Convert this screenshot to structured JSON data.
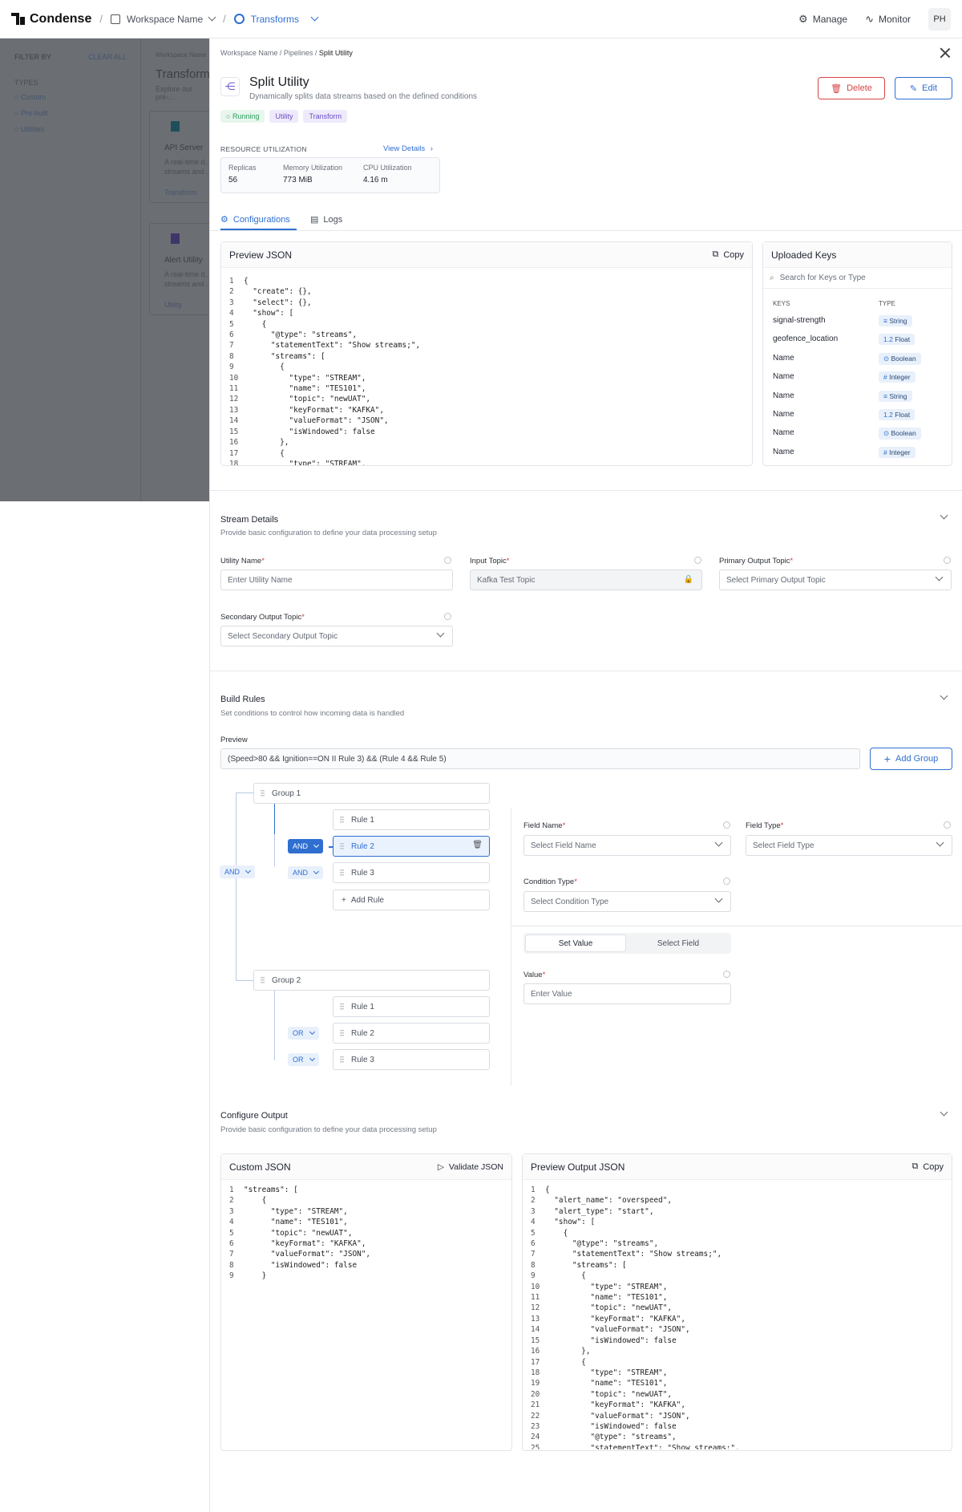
{
  "topbar": {
    "brand": "Condense",
    "workspace": "Workspace Name",
    "section": "Transforms",
    "nav": [
      "Manage",
      "Monitor"
    ],
    "avatar": "PH"
  },
  "background": {
    "filter_by": "FILTER BY",
    "clear_all": "CLEAR ALL",
    "types": "TYPES",
    "options": [
      "Custom",
      "Pre-built",
      "Utilities"
    ],
    "crumb": "Workspace Name",
    "heading": "Transforms",
    "desc": "Explore our pre-...",
    "cards": [
      {
        "title": "API Server",
        "line1": "A real-time d...",
        "line2": "streams and ...",
        "tag": "Transform"
      },
      {
        "title": "Alert Utility",
        "line1": "A real-time d...",
        "line2": "streams and ...",
        "tag": "Utility"
      }
    ]
  },
  "panel": {
    "breadcrumb": [
      "Workspace Name",
      "Pipelines",
      "Split Utility"
    ],
    "title": "Split Utility",
    "subtitle": "Dynamically splits data streams based on the defined conditions",
    "tags": [
      "Running",
      "Utility",
      "Transform"
    ],
    "delete_label": "Delete",
    "edit_label": "Edit",
    "resource": {
      "heading": "RESOURCE UTILIZATION",
      "link": "View Details",
      "metrics": [
        {
          "label": "Replicas",
          "value": "56"
        },
        {
          "label": "Memory Utilization",
          "value": "773 MiB"
        },
        {
          "label": "CPU Utilization",
          "value": "4.16 m"
        }
      ]
    },
    "tabs": [
      "Configurations",
      "Logs"
    ],
    "preview_json": {
      "title": "Preview JSON",
      "copy": "Copy",
      "lines": [
        "{",
        "  \"create\": {},",
        "  \"select\": {},",
        "  \"show\": [",
        "    {",
        "      \"@type\": \"streams\",",
        "      \"statementText\": \"Show streams;\",",
        "      \"streams\": [",
        "        {",
        "          \"type\": \"STREAM\",",
        "          \"name\": \"TES101\",",
        "          \"topic\": \"newUAT\",",
        "          \"keyFormat\": \"KAFKA\",",
        "          \"valueFormat\": \"JSON\",",
        "          \"isWindowed\": false",
        "        },",
        "        {",
        "          \"type\": \"STREAM\","
      ]
    },
    "uploaded_keys": {
      "title": "Uploaded Keys",
      "search_placeholder": "Search for Keys or Type",
      "col_keys": "KEYS",
      "col_type": "TYPE",
      "rows": [
        {
          "key": "signal-strength",
          "type": "String",
          "icon": "≡"
        },
        {
          "key": "geofence_location",
          "type": "Float",
          "icon": "1.2"
        },
        {
          "key": "Name",
          "type": "Boolean",
          "icon": "⊙"
        },
        {
          "key": "Name",
          "type": "Integer",
          "icon": "#"
        },
        {
          "key": "Name",
          "type": "String",
          "icon": "≡"
        },
        {
          "key": "Name",
          "type": "Float",
          "icon": "1.2"
        },
        {
          "key": "Name",
          "type": "Boolean",
          "icon": "⊙"
        },
        {
          "key": "Name",
          "type": "Integer",
          "icon": "#"
        }
      ]
    },
    "stream_details": {
      "title": "Stream Details",
      "subtitle": "Provide basic configuration to define your data processing setup",
      "utility_name_label": "Utility Name",
      "utility_name_placeholder": "Enter Utility Name",
      "input_topic_label": "Input Topic",
      "input_topic_value": "Kafka Test Topic",
      "primary_label": "Primary Output Topic",
      "primary_placeholder": "Select Primary Output Topic",
      "secondary_label": "Secondary Output Topic",
      "secondary_placeholder": "Select Secondary Output Topic"
    },
    "build_rules": {
      "title": "Build Rules",
      "subtitle": "Set conditions to control how incoming data is handled",
      "preview_label": "Preview",
      "preview_value": "(Speed>80 && Ignition==ON II Rule 3) && (Rule 4 && Rule 5)",
      "add_group": "Add Group",
      "root_op": "AND",
      "group1": {
        "name": "Group 1",
        "rules": [
          "Rule 1",
          "Rule 2",
          "Rule 3"
        ],
        "ops": [
          "AND",
          "AND"
        ],
        "add_rule": "Add Rule"
      },
      "group2": {
        "name": "Group 2",
        "rules": [
          "Rule 1",
          "Rule 2",
          "Rule 3"
        ],
        "ops": [
          "OR",
          "OR"
        ]
      },
      "field_name_label": "Field Name",
      "field_name_placeholder": "Select Field Name",
      "field_type_label": "Field Type",
      "field_type_placeholder": "Select Field Type",
      "condition_label": "Condition Type",
      "condition_placeholder": "Select Condition Type",
      "toggle": [
        "Set Value",
        "Select Field"
      ],
      "value_label": "Value",
      "value_placeholder": "Enter Value"
    },
    "configure_output": {
      "title": "Configure Output",
      "subtitle": "Provide basic configuration to define your data processing setup",
      "custom_title": "Custom JSON",
      "validate": "Validate JSON",
      "custom_lines": [
        "\"streams\": [",
        "    {",
        "      \"type\": \"STREAM\",",
        "      \"name\": \"TES101\",",
        "      \"topic\": \"newUAT\",",
        "      \"keyFormat\": \"KAFKA\",",
        "      \"valueFormat\": \"JSON\",",
        "      \"isWindowed\": false",
        "    }"
      ],
      "preview_title": "Preview Output JSON",
      "copy": "Copy",
      "preview_lines": [
        "{",
        "  \"alert_name\": \"overspeed\",",
        "  \"alert_type\": \"start\",",
        "  \"show\": [",
        "    {",
        "      \"@type\": \"streams\",",
        "      \"statementText\": \"Show streams;\",",
        "      \"streams\": [",
        "        {",
        "          \"type\": \"STREAM\",",
        "          \"name\": \"TES101\",",
        "          \"topic\": \"newUAT\",",
        "          \"keyFormat\": \"KAFKA\",",
        "          \"valueFormat\": \"JSON\",",
        "          \"isWindowed\": false",
        "        },",
        "        {",
        "          \"type\": \"STREAM\",",
        "          \"name\": \"TES101\",",
        "          \"topic\": \"newUAT\",",
        "          \"keyFormat\": \"KAFKA\",",
        "          \"valueFormat\": \"JSON\",",
        "          \"isWindowed\": false",
        "          \"@type\": \"streams\",",
        "          \"statementText\": \"Show streams;\","
      ]
    }
  },
  "colors": {
    "accent": "#2f6fd0",
    "danger": "#d64545",
    "running": "#2e9e5b"
  }
}
